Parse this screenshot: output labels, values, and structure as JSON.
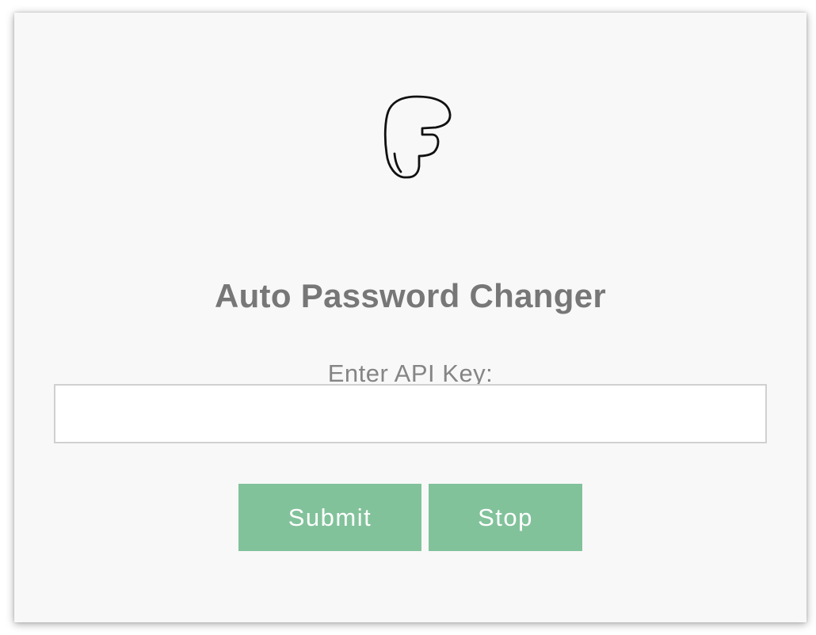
{
  "app": {
    "logo_icon": "stylized-f-logo-icon",
    "title": "Auto Password Changer"
  },
  "form": {
    "api_key_label": "Enter API Key:",
    "api_key_value": "",
    "api_key_placeholder": ""
  },
  "actions": {
    "submit_label": "Submit",
    "stop_label": "Stop"
  },
  "colors": {
    "panel_background": "#f8f8f8",
    "title_text": "#777777",
    "label_text": "#858585",
    "button_background": "#82c29b",
    "button_text": "#ffffff",
    "input_border": "#d0d0d0"
  }
}
